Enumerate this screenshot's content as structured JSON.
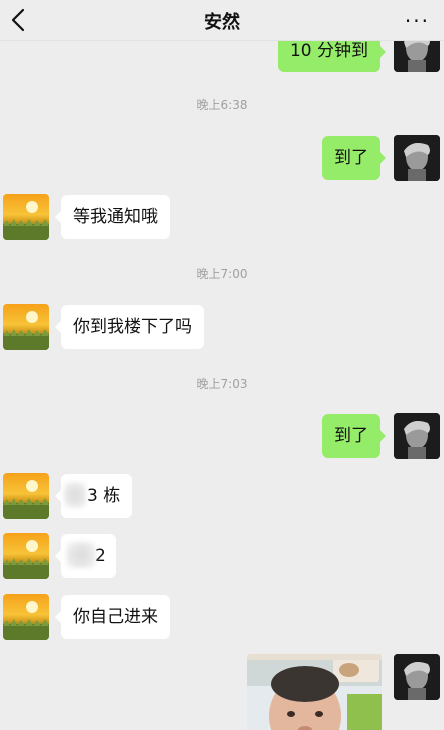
{
  "header": {
    "title": "安然",
    "back_icon": "chevron-left-icon",
    "more_icon": "more-dots-icon",
    "more_label": "···"
  },
  "messages": {
    "m0": {
      "text": "10 分钟到",
      "side": "right"
    },
    "t1": "晚上6:38",
    "m1": {
      "text": "到了",
      "side": "right"
    },
    "m2": {
      "text": "等我通知哦",
      "side": "left"
    },
    "t2": "晚上7:00",
    "m3": {
      "text": "你到我楼下了吗",
      "side": "left"
    },
    "t3": "晚上7:03",
    "m4": {
      "text": "到了",
      "side": "right"
    },
    "m5": {
      "text": "3 栋",
      "side": "left"
    },
    "m6": {
      "text": "2",
      "side": "left"
    },
    "m7": {
      "text": "你自己进来",
      "side": "left"
    },
    "m8": {
      "type": "image",
      "side": "right"
    }
  },
  "colors": {
    "background": "#ededed",
    "my_bubble": "#95ec69",
    "their_bubble": "#ffffff",
    "timestamp": "#a0a0a0"
  }
}
